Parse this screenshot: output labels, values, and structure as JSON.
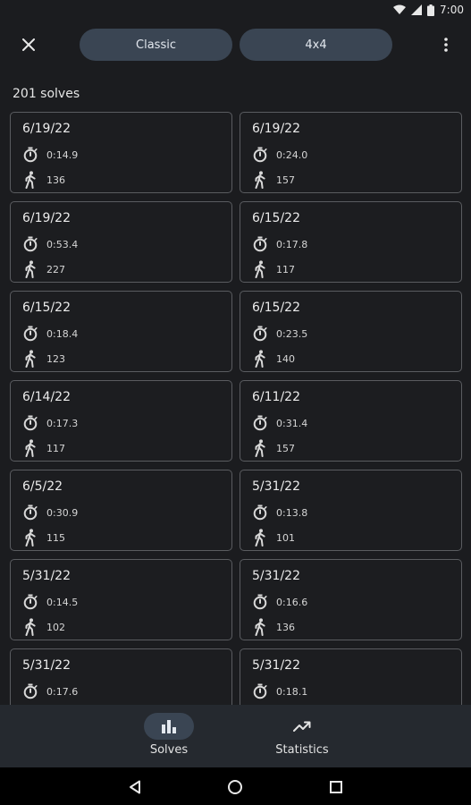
{
  "status": {
    "time": "7:00"
  },
  "header": {
    "mode_chip": "Classic",
    "size_chip": "4x4"
  },
  "summary": {
    "count_label": "201 solves"
  },
  "solves": [
    {
      "date": "6/19/22",
      "time": "0:14.9",
      "moves": "136"
    },
    {
      "date": "6/19/22",
      "time": "0:24.0",
      "moves": "157"
    },
    {
      "date": "6/19/22",
      "time": "0:53.4",
      "moves": "227"
    },
    {
      "date": "6/15/22",
      "time": "0:17.8",
      "moves": "117"
    },
    {
      "date": "6/15/22",
      "time": "0:18.4",
      "moves": "123"
    },
    {
      "date": "6/15/22",
      "time": "0:23.5",
      "moves": "140"
    },
    {
      "date": "6/14/22",
      "time": "0:17.3",
      "moves": "117"
    },
    {
      "date": "6/11/22",
      "time": "0:31.4",
      "moves": "157"
    },
    {
      "date": "6/5/22",
      "time": "0:30.9",
      "moves": "115"
    },
    {
      "date": "5/31/22",
      "time": "0:13.8",
      "moves": "101"
    },
    {
      "date": "5/31/22",
      "time": "0:14.5",
      "moves": "102"
    },
    {
      "date": "5/31/22",
      "time": "0:16.6",
      "moves": "136"
    },
    {
      "date": "5/31/22",
      "time": "0:17.6",
      "moves": ""
    },
    {
      "date": "5/31/22",
      "time": "0:18.1",
      "moves": ""
    }
  ],
  "bottom_nav": {
    "solves_label": "Solves",
    "statistics_label": "Statistics"
  },
  "icons": {
    "time": "stopwatch-icon",
    "moves": "walking-person-icon",
    "solves_tab": "bar-chart-icon",
    "statistics_tab": "trending-up-icon"
  },
  "colors": {
    "background": "#1b1c1f",
    "chip": "#3a4553",
    "card_border": "#5a5c60",
    "nav_bar": "#25292f"
  }
}
